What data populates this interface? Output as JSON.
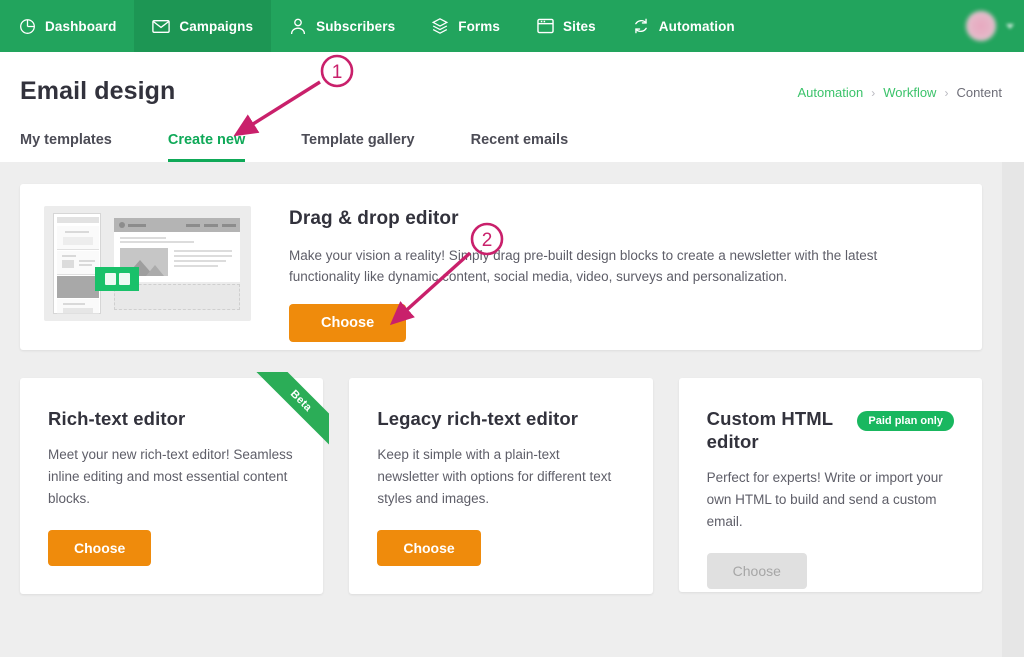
{
  "topnav": {
    "items": [
      {
        "label": "Dashboard",
        "icon": "pie-chart-icon",
        "active": false
      },
      {
        "label": "Campaigns",
        "icon": "envelope-icon",
        "active": true
      },
      {
        "label": "Subscribers",
        "icon": "person-icon",
        "active": false
      },
      {
        "label": "Forms",
        "icon": "layers-icon",
        "active": false
      },
      {
        "label": "Sites",
        "icon": "browser-window-icon",
        "active": false
      },
      {
        "label": "Automation",
        "icon": "refresh-cycle-icon",
        "active": false
      }
    ],
    "user": {
      "name": "",
      "avatar_icon": "avatar",
      "caret_icon": "chevron-down-icon"
    },
    "background_color": "#22a45d",
    "active_color": "#1d9654"
  },
  "header": {
    "title": "Email design",
    "breadcrumb": [
      {
        "label": "Automation",
        "link": true
      },
      {
        "label": "Workflow",
        "link": true
      },
      {
        "label": "Content",
        "link": false
      }
    ],
    "breadcrumb_separator": "›",
    "tabs": [
      {
        "label": "My templates",
        "active": false
      },
      {
        "label": "Create new",
        "active": true
      },
      {
        "label": "Template gallery",
        "active": false
      },
      {
        "label": "Recent emails",
        "active": false
      }
    ],
    "accent_color": "#0fa958"
  },
  "main": {
    "featured": {
      "title": "Drag & drop editor",
      "description": "Make your vision a reality! Simply drag pre-built design blocks to create a newsletter with the latest functionality like dynamic content, social media, video, surveys and personalization.",
      "button_label": "Choose",
      "button_color": "#ef8b0c",
      "thumbnail_icon": "email-template-preview"
    },
    "cards": [
      {
        "title": "Rich-text editor",
        "description": "Meet your new rich-text editor! Seamless inline editing and most essential content blocks.",
        "button_label": "Choose",
        "button_disabled": false,
        "ribbon_label": "Beta",
        "ribbon_color": "#2bad57",
        "badge_label": ""
      },
      {
        "title": "Legacy rich-text editor",
        "description": "Keep it simple with a plain-text newsletter with options for different text styles and images.",
        "button_label": "Choose",
        "button_disabled": false,
        "ribbon_label": "",
        "badge_label": ""
      },
      {
        "title": "Custom HTML editor",
        "description": "Perfect for experts! Write or import your own HTML to build and send a custom email.",
        "button_label": "Choose",
        "button_disabled": true,
        "ribbon_label": "",
        "badge_label": "Paid plan only",
        "badge_color": "#19b75f"
      }
    ]
  },
  "annotations": {
    "color": "#c9206b",
    "markers": [
      {
        "label": "1",
        "target": "create-new-tab"
      },
      {
        "label": "2",
        "target": "drag-drop-choose-button"
      }
    ]
  }
}
